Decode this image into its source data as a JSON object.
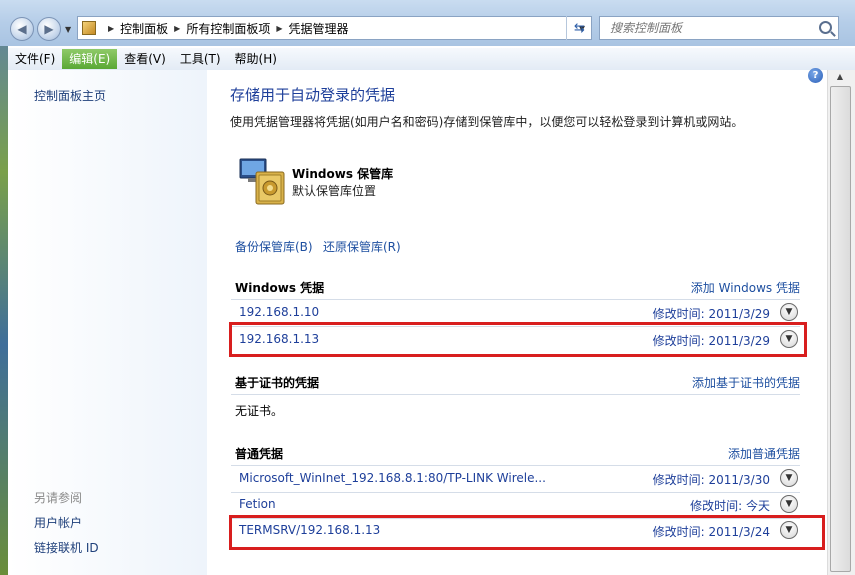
{
  "window": {
    "breadcrumb": [
      "控制面板",
      "所有控制面板项",
      "凭据管理器"
    ],
    "search_placeholder": "搜索控制面板"
  },
  "menubar": [
    "文件(F)",
    "编辑(E)",
    "查看(V)",
    "工具(T)",
    "帮助(H)"
  ],
  "sidebar": {
    "home_link": "控制面板主页",
    "see_also": "另请参阅",
    "links": [
      "用户帐户",
      "链接联机 ID"
    ]
  },
  "main": {
    "heading": "存储用于自动登录的凭据",
    "description": "使用凭据管理器将凭据(如用户名和密码)存储到保管库中，以便您可以轻松登录到计算机或网站。",
    "vault_title": "Windows 保管库",
    "vault_subtitle": "默认保管库位置",
    "backup_link": "备份保管库(B)",
    "restore_link": "还原保管库(R)",
    "windows_section": {
      "title": "Windows 凭据",
      "add_link": "添加 Windows 凭据",
      "items": [
        {
          "label": "192.168.1.10",
          "date": "修改时间:  2011/3/29"
        },
        {
          "label": "192.168.1.13",
          "date": "修改时间:  2011/3/29"
        }
      ]
    },
    "cert_section": {
      "title": "基于证书的凭据",
      "add_link": "添加基于证书的凭据",
      "empty_text": "无证书。"
    },
    "generic_section": {
      "title": "普通凭据",
      "add_link": "添加普通凭据",
      "items": [
        {
          "label": "Microsoft_WinInet_192.168.8.1:80/TP-LINK Wirele...",
          "date": "修改时间:  2011/3/30"
        },
        {
          "label": "Fetion",
          "date": "修改时间:  今天"
        },
        {
          "label": "TERMSRV/192.168.1.13",
          "date": "修改时间:  2011/3/24"
        }
      ]
    }
  },
  "colors": {
    "link": "#1e4fa0",
    "highlight_box": "#d81e1e",
    "active_menu": "#59a835"
  }
}
